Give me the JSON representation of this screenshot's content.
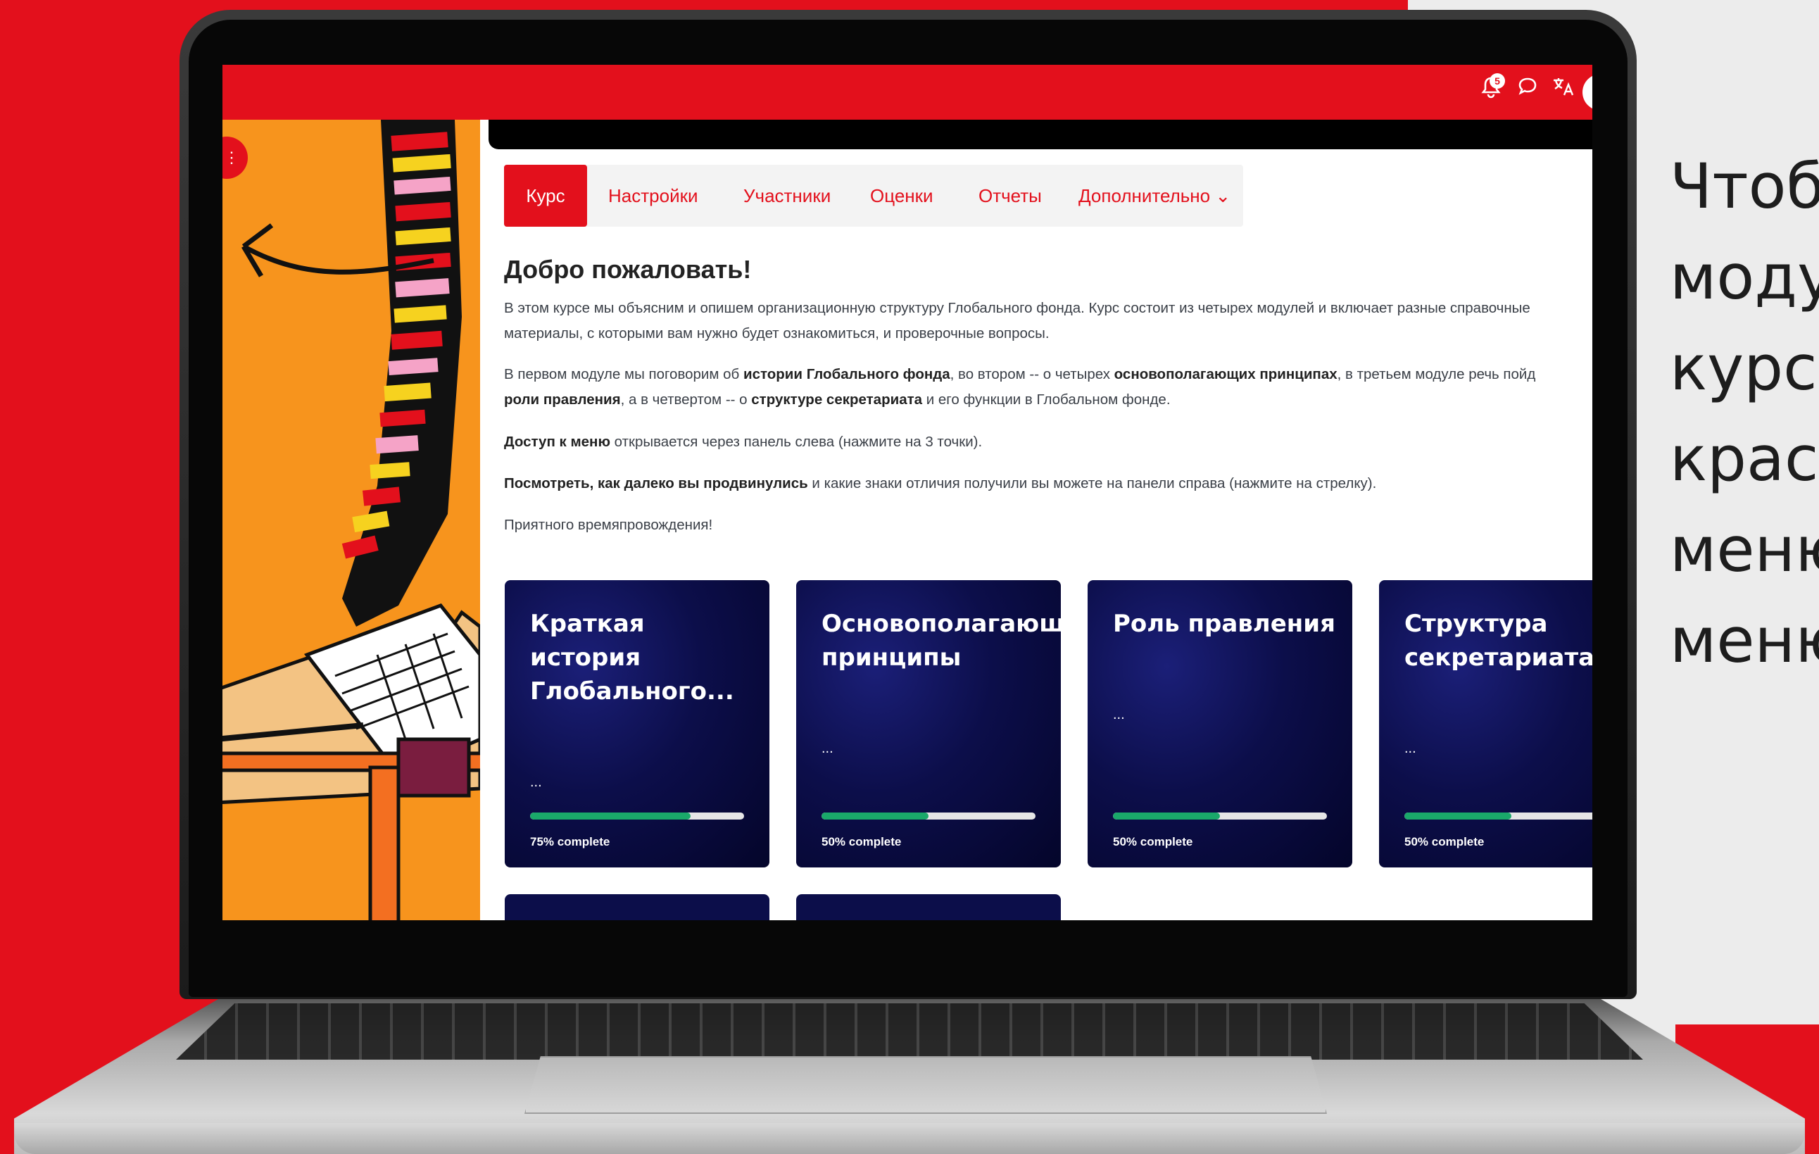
{
  "colors": {
    "brand_red": "#e3101c",
    "progress_green": "#1aa86a",
    "card_navy": "#0c0e4a"
  },
  "side_text": {
    "lines": [
      "Чтоб",
      "моду",
      "курса",
      "краси",
      "меню",
      "меню"
    ]
  },
  "topbar": {
    "notification_count": "5",
    "icons": [
      "bell-icon",
      "chat-icon",
      "translate-icon",
      "user-avatar"
    ]
  },
  "tabs": [
    {
      "label": "Курс",
      "active": true
    },
    {
      "label": "Настройки"
    },
    {
      "label": "Участники"
    },
    {
      "label": "Оценки"
    },
    {
      "label": "Отчеты"
    },
    {
      "label": "Дополнительно ⌄"
    }
  ],
  "welcome": {
    "title": "Добро пожаловать!",
    "p1_line1": "В этом курсе мы объясним и опишем организационную структуру Глобального фонда. Курс состоит из четырех модулей и включает разные справочные",
    "p1_line2": "материалы, с которыми вам нужно будет ознакомиться, и проверочные вопросы.",
    "p2_a": "В первом модуле мы поговорим об ",
    "p2_b": "истории Глобального фонда",
    "p2_c": ", во втором -- о четырех ",
    "p2_d": "основополагающих принципах",
    "p2_e": ", в третьем модуле речь пойд",
    "p2_f": "роли правления",
    "p2_g": ", а в четвертом -- о ",
    "p2_h": "структуре секретариата",
    "p2_i": " и его функции в Глобальном фонде.",
    "p3_a": "Доступ к меню",
    "p3_b": " открывается через панель слева (нажмите на 3 точки).",
    "p4_a": "Посмотреть, как далеко вы продвинулись",
    "p4_b": " и какие знаки отличия получили вы можете на панели справа (нажмите на стрелку).",
    "p5": "Приятного времяпровождения!"
  },
  "modules": [
    {
      "title_lines": [
        "Краткая",
        "история",
        "Глобального..."
      ],
      "dots": "...",
      "progress": 0.75,
      "progress_label": "75% complete"
    },
    {
      "title_lines": [
        "Основополагающ",
        "принципы"
      ],
      "dots": "...",
      "progress": 0.5,
      "progress_label": "50% complete"
    },
    {
      "title_lines": [
        "Роль правления"
      ],
      "dots": "...",
      "progress": 0.5,
      "progress_label": "50% complete"
    },
    {
      "title_lines": [
        "Структура",
        "секретариата"
      ],
      "dots": "...",
      "progress": 0.5,
      "progress_label": "50% complete"
    }
  ]
}
